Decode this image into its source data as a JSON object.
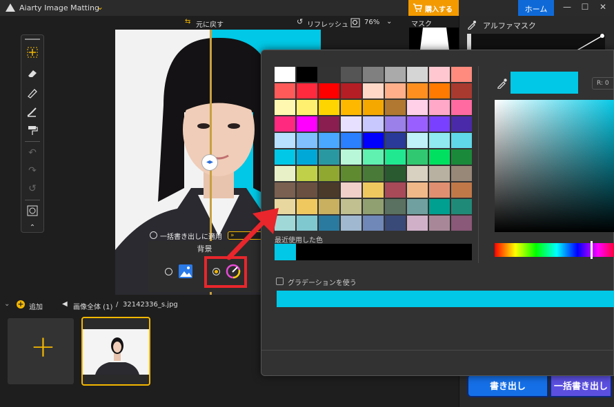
{
  "app": {
    "title": "Aiarty Image Matting"
  },
  "titlebar": {
    "buy_label": "購入する",
    "home_label": "ホーム"
  },
  "toolbar": {
    "undo_label": "元に戻す",
    "refresh_label": "リフレッシュ",
    "zoom": "76%"
  },
  "canvas_popup": {
    "apply_batch_label": "一括書き出しに適用",
    "background_title": "背景"
  },
  "right_panel": {
    "mask_label": "マスク",
    "alpha_mask_label": "アルファマスク",
    "export_label": "書き出し",
    "batch_export_label": "一括書き出し"
  },
  "bottom": {
    "add_label": "追加",
    "breadcrumb_all": "画像全体 (1)",
    "separator": "/",
    "filename": "32142336_s.jpg"
  },
  "picker": {
    "recent_label": "最近使用した色",
    "gradient_label": "グラデーションを使う",
    "r_label": "R:",
    "r_value": "0",
    "current_color": "#00c8e6",
    "recent_colors": [
      "#00c8e6"
    ],
    "swatches": [
      "#ffffff",
      "#000000",
      "#333333",
      "#555555",
      "#808080",
      "#aaaaaa",
      "#d5d5d5",
      "#ffc8d0",
      "#ff8b7e",
      "#ff5a5a",
      "#ff2a3e",
      "#ff0000",
      "#b51e24",
      "#ffd8c8",
      "#ffb08a",
      "#ff9020",
      "#ff7a00",
      "#a83a30",
      "#fff8b0",
      "#fff070",
      "#ffd500",
      "#ffb800",
      "#f5a800",
      "#b07830",
      "#ffd0e8",
      "#ffa8c8",
      "#ff6aa0",
      "#ff2a80",
      "#ff00ff",
      "#8a1e50",
      "#e8e0ff",
      "#c8c8ff",
      "#9a80e8",
      "#9a60ff",
      "#7a40ff",
      "#4a2aa8",
      "#b8e0ff",
      "#80c0ff",
      "#4aa8ff",
      "#2a80ff",
      "#0000ff",
      "#2a3a98",
      "#c0f0f8",
      "#90e8f0",
      "#60d8e8",
      "#00c8e6",
      "#00a8d8",
      "#2a98a0",
      "#b8f8d8",
      "#60f0b0",
      "#20e890",
      "#30c870",
      "#00e060",
      "#1a8a3a",
      "#e8f0c8",
      "#c0d048",
      "#90a830",
      "#608a30",
      "#4a7a38",
      "#2a5a30",
      "#d8d0c0",
      "#b8b0a0",
      "#988878",
      "#7a6050",
      "#6a5040",
      "#4a3a2a",
      "#f0d0c8",
      "#f0c860",
      "#a84a58",
      "#f0b888",
      "#e09070",
      "#c07848",
      "#e8d8a0",
      "#f0c860",
      "#c8b060",
      "#c0c090",
      "#90a070",
      "#5a7060",
      "#70a0a0",
      "#00a090",
      "#208a78",
      "#a0d8d8",
      "#80c8d0",
      "#2a7aa0",
      "#a0b8d0",
      "#7088b8",
      "#3a4a78",
      "#d0b0c8",
      "#a88898",
      "#8a5878"
    ]
  }
}
